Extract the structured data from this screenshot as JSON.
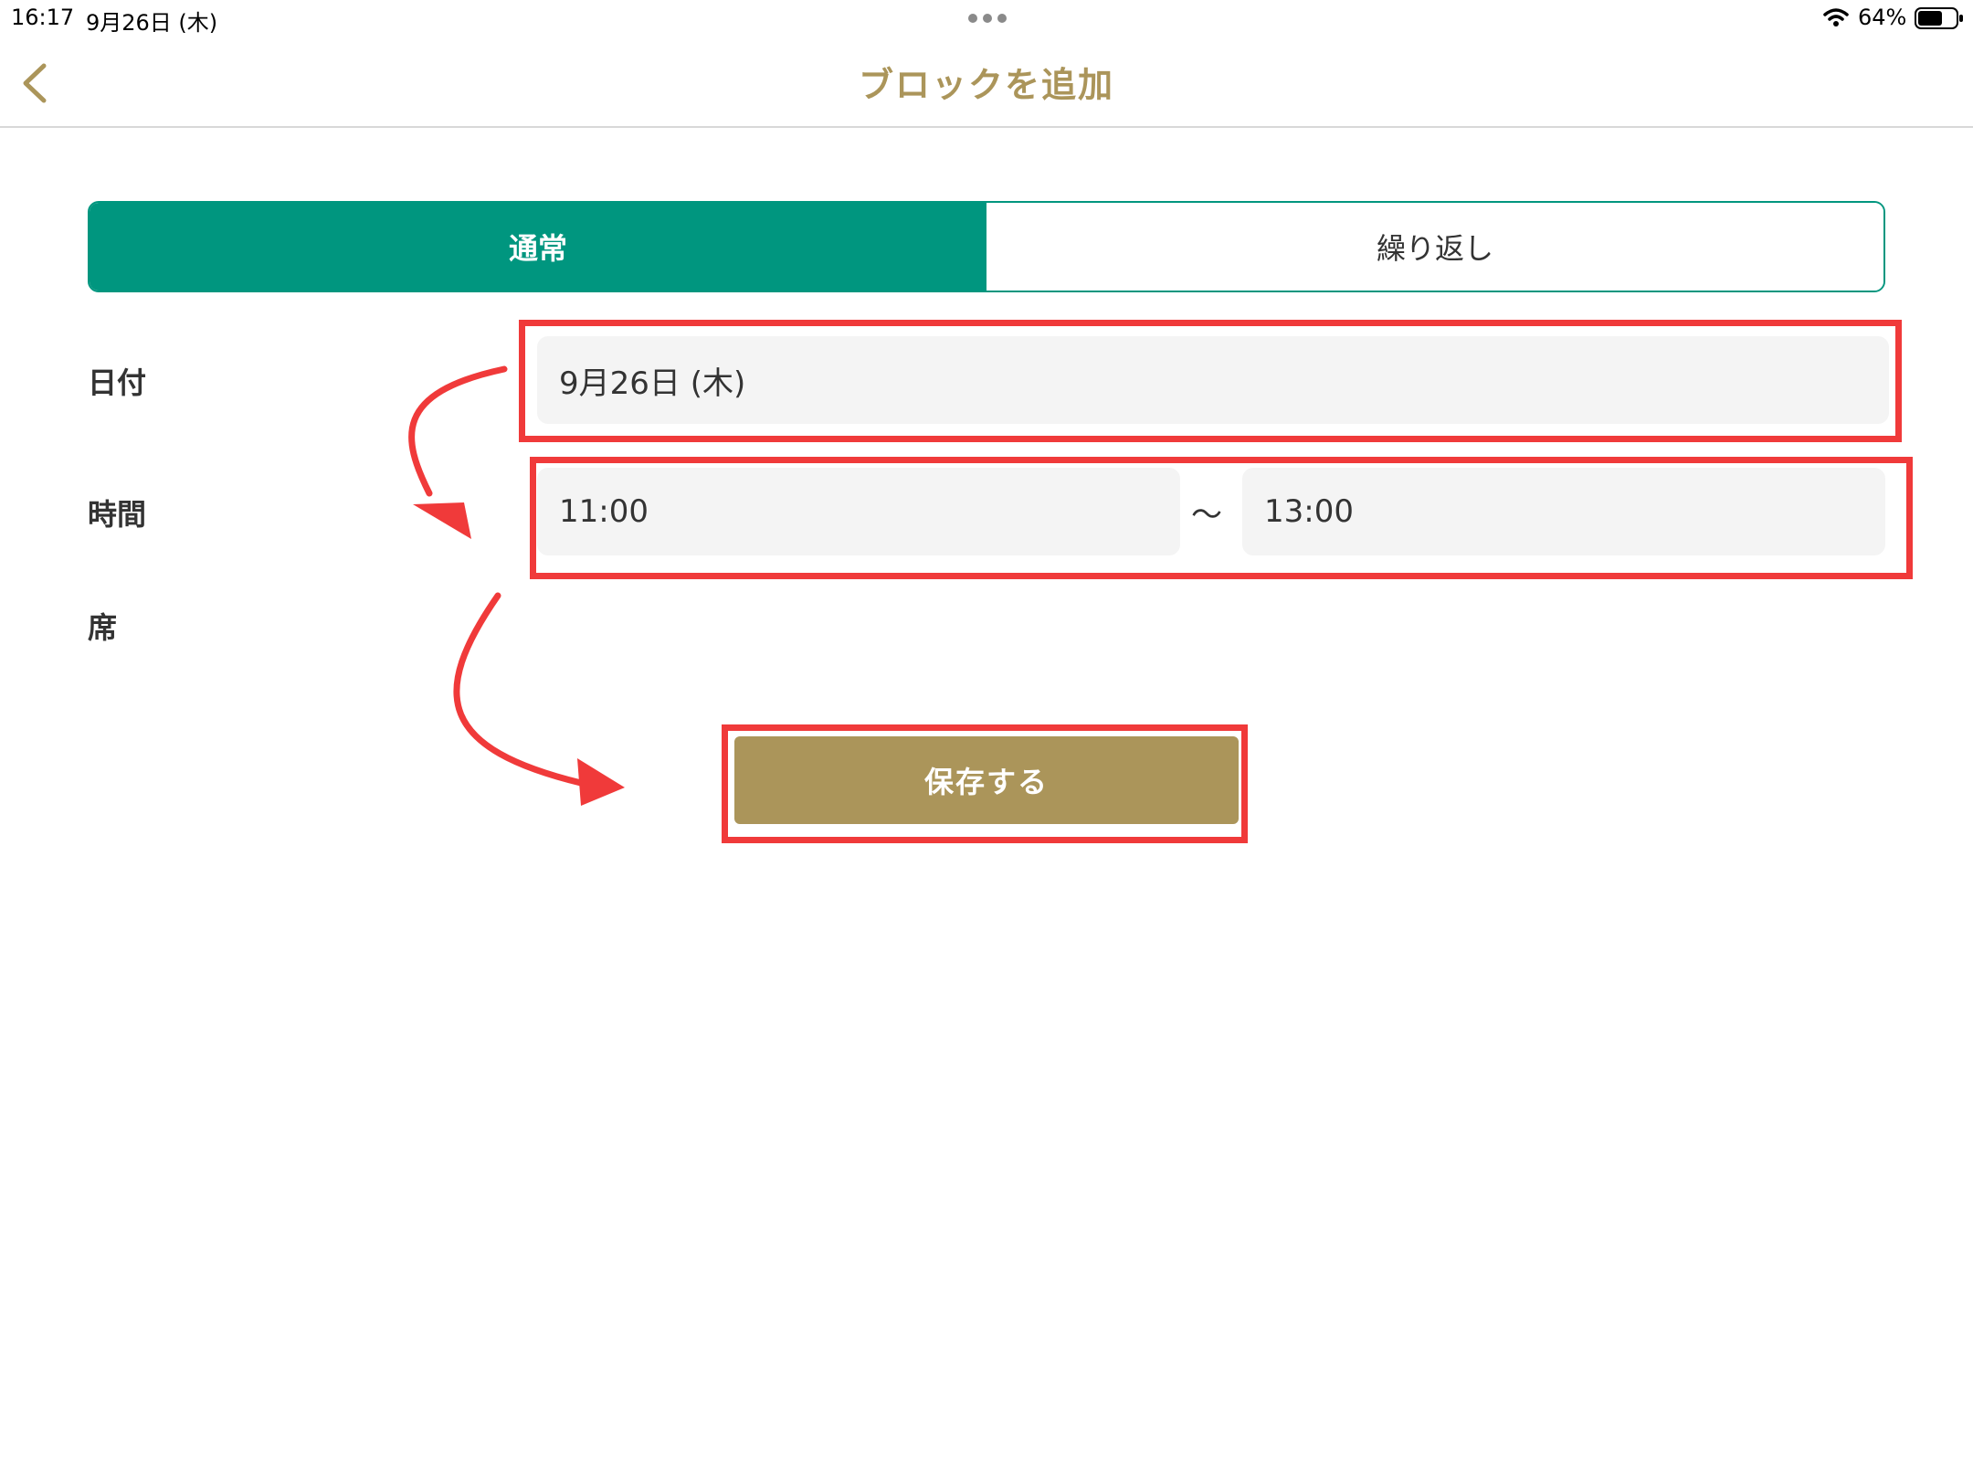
{
  "status_bar": {
    "time": "16:17",
    "date": "9月26日 (木)",
    "battery_percent": "64%",
    "battery_level": 0.64,
    "icons": [
      "more-dots-icon",
      "wifi-icon",
      "battery-icon"
    ]
  },
  "nav": {
    "title": "ブロックを追加",
    "back_icon": "chevron-left-icon"
  },
  "segments": {
    "items": [
      {
        "label": "通常",
        "selected": true
      },
      {
        "label": "繰り返し",
        "selected": false
      }
    ]
  },
  "form": {
    "date_label": "日付",
    "date_value": "9月26日 (木)",
    "time_label": "時間",
    "time_start": "11:00",
    "time_separator": "〜",
    "time_end": "13:00",
    "seat_label": "席"
  },
  "save_button_label": "保存する",
  "colors": {
    "accent_gold": "#ab955a",
    "teal": "#00967f",
    "annotation_red": "#f03a3a",
    "input_bg": "#f4f4f4"
  }
}
